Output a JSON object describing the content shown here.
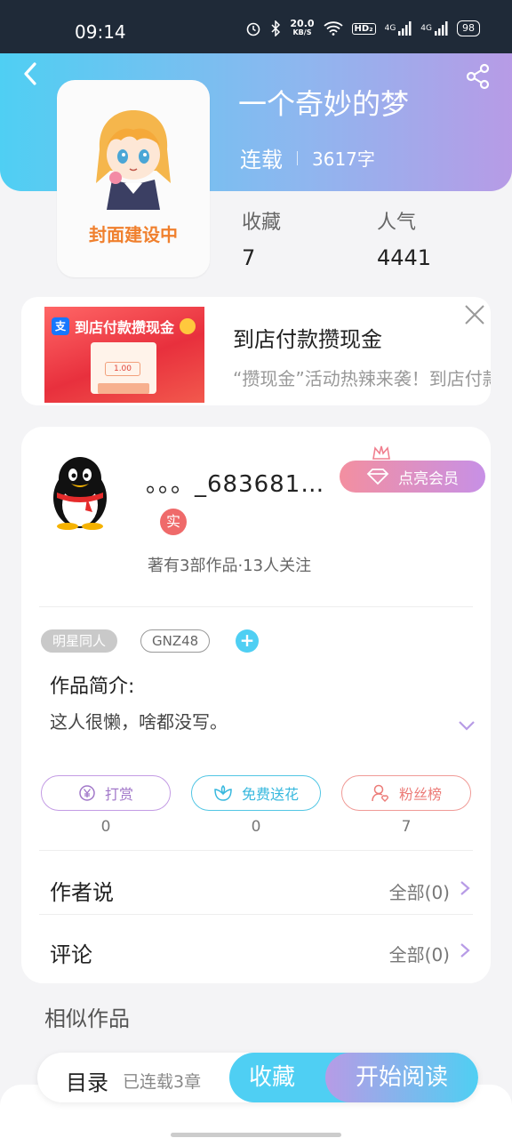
{
  "status_bar": {
    "time": "09:14",
    "net_speed_value": "20.0",
    "net_speed_unit": "KB/S",
    "hd": "HD₂",
    "signal1": "4G",
    "signal2": "4G",
    "battery": "98"
  },
  "book": {
    "title": "一个奇妙的梦",
    "status": "连载",
    "word_count": "3617字",
    "cover_caption": "封面建设中",
    "favorites_label": "收藏",
    "favorites_value": "7",
    "popularity_label": "人气",
    "popularity_value": "4441"
  },
  "ad": {
    "image_title": "到店付款攒现金",
    "image_amount": "1.00",
    "title": "到店付款攒现金",
    "description": "“攒现金”活动热辣来袭！到店付款攒现金！"
  },
  "author": {
    "name": "。。。_683681…",
    "real_badge": "实",
    "vip_button": "点亮会员",
    "meta": "著有3部作品·13人关注"
  },
  "tags": [
    "明星同人",
    "GNZ48"
  ],
  "add_tag": "+",
  "intro": {
    "title": "作品简介:",
    "text": "这人很懒，啥都没写。"
  },
  "actions": [
    {
      "label": "打赏",
      "count": "0",
      "icon": "yen-coin-icon"
    },
    {
      "label": "免费送花",
      "count": "0",
      "icon": "flower-icon"
    },
    {
      "label": "粉丝榜",
      "count": "7",
      "icon": "fan-user-icon"
    }
  ],
  "rows": [
    {
      "label": "作者说",
      "right": "全部(0)"
    },
    {
      "label": "评论",
      "right": "全部(0)"
    }
  ],
  "similar_title": "相似作品",
  "bottom_bar": {
    "toc": "目录",
    "chapters": "已连载3章",
    "favorite": "收藏",
    "read": "开始阅读"
  },
  "colors": {
    "accent_cyan": "#4fcff3",
    "accent_purple": "#b79be6",
    "cover_text": "#f0802e"
  }
}
